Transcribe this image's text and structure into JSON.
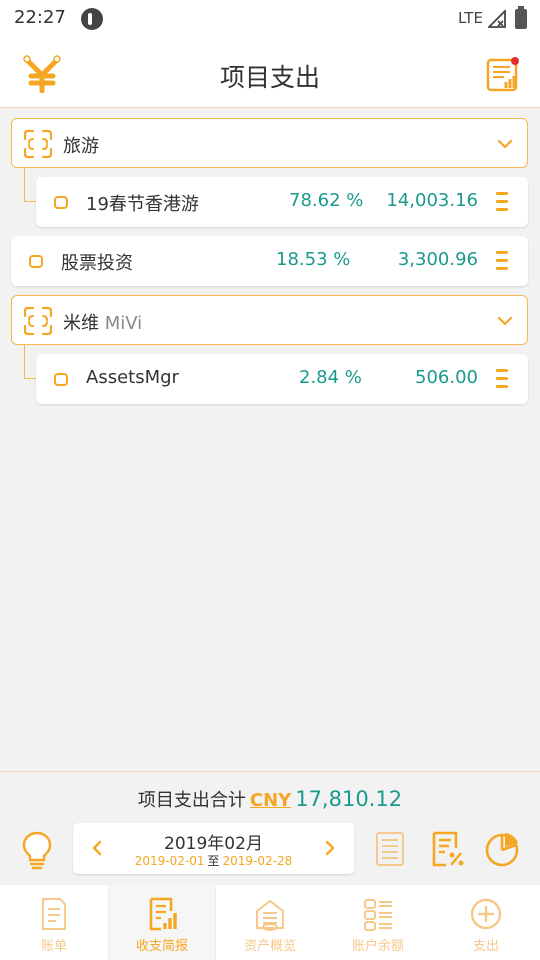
{
  "status_bar": {
    "time": "22:27",
    "network": "LTE"
  },
  "header": {
    "title": "项目支出"
  },
  "rows": [
    {
      "type": "group",
      "name": "旅游",
      "sub": ""
    },
    {
      "type": "item",
      "name": "19春节香港游",
      "percent": "78.62 %",
      "amount": "14,003.16"
    },
    {
      "type": "item",
      "name": "股票投资",
      "percent": "18.53 %",
      "amount": "3,300.96"
    },
    {
      "type": "group",
      "name": "米维",
      "sub": "MiVi"
    },
    {
      "type": "item",
      "name": "AssetsMgr",
      "percent": "2.84 %",
      "amount": "506.00"
    }
  ],
  "summary": {
    "label": "项目支出合计",
    "currency": "CNY",
    "total": "17,810.12"
  },
  "date_selector": {
    "month": "2019年02月",
    "start": "2019-02-01",
    "separator": "至",
    "end": "2019-02-28"
  },
  "tabs": [
    {
      "label": "账单",
      "icon": "bill-icon"
    },
    {
      "label": "收支简报",
      "icon": "report-icon"
    },
    {
      "label": "资产概览",
      "icon": "assets-icon"
    },
    {
      "label": "账户余额",
      "icon": "balance-icon"
    },
    {
      "label": "支出",
      "icon": "add-expense-icon"
    }
  ],
  "colors": {
    "accent": "#f5a623",
    "amount": "#1a9a8c",
    "inactive_tab": "#f6c98a"
  }
}
